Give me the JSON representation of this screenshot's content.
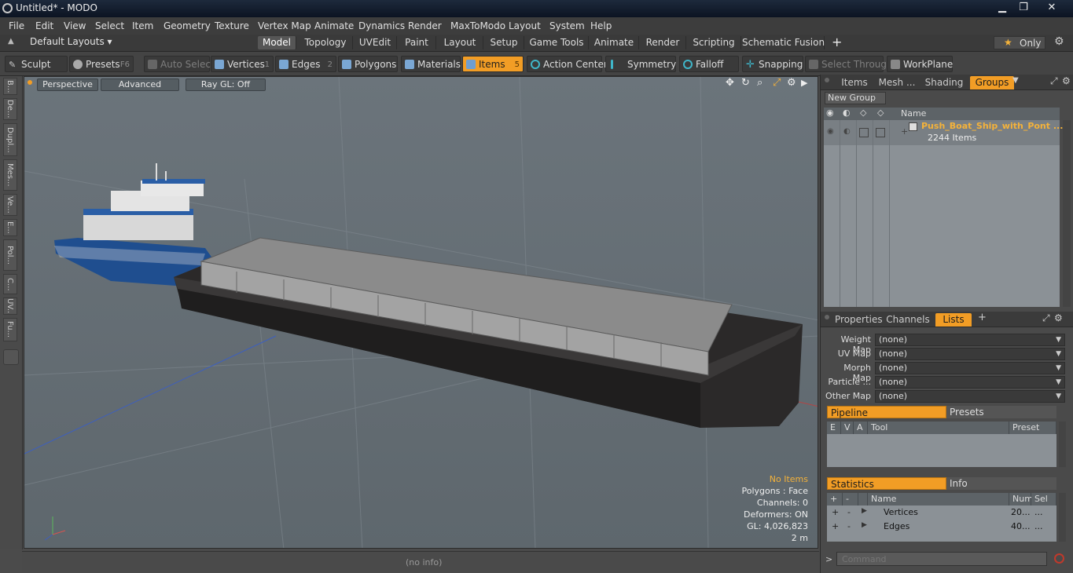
{
  "window": {
    "title": "Untitled* - MODO",
    "minimize": "▁",
    "restore": "❐",
    "close": "✕"
  },
  "menu": [
    "File",
    "Edit",
    "View",
    "Select",
    "Item",
    "Geometry",
    "Texture",
    "Vertex Map",
    "Animate",
    "Dynamics",
    "Render",
    "MaxToModo",
    "Layout",
    "System",
    "Help"
  ],
  "layouts": {
    "label": "Default Layouts ▾",
    "tabs": [
      "Model",
      "Topology",
      "UVEdit",
      "Paint",
      "Layout",
      "Setup",
      "Game Tools",
      "Animate",
      "Render",
      "Scripting",
      "Schematic Fusion"
    ],
    "active": "Model",
    "add": "+",
    "only": "Only",
    "star": "★"
  },
  "toolbar": {
    "sculpt": "Sculpt",
    "presets": "Presets",
    "presets_key": "F6",
    "auto_select": "Auto Select",
    "vertices": "Vertices",
    "vertices_num": "1",
    "edges": "Edges",
    "edges_num": "2",
    "polygons": "Polygons",
    "materials": "Materials",
    "items": "Items",
    "items_num": "5",
    "action_center": "Action Center",
    "symmetry": "Symmetry",
    "falloff": "Falloff",
    "snapping": "Snapping",
    "select_through": "Select Through",
    "workplane": "WorkPlane"
  },
  "left_tabs": [
    "B...",
    "De...",
    "Dupl...",
    "Mes...",
    "Ve...",
    "E...",
    "Pol...",
    "C...",
    "UV...",
    "Fu..."
  ],
  "viewport": {
    "perspective": "Perspective",
    "advanced": "Advanced",
    "raygl": "Ray GL: Off",
    "hud": {
      "selection": "No Items",
      "polygons": "Polygons : Face",
      "channels": "Channels: 0",
      "deformers": "Deformers: ON",
      "gl": "GL: 4,026,823",
      "scale": "2 m"
    }
  },
  "status": {
    "info": "(no info)"
  },
  "groups_panel": {
    "tabs": [
      "Items",
      "Mesh ...",
      "Shading",
      "Groups"
    ],
    "active": "Groups",
    "new_group": "New Group",
    "column_name": "Name",
    "group": {
      "name": "Push_Boat_Ship_with_Pont ...",
      "count": "2244 Items"
    }
  },
  "lists_panel": {
    "tabs": [
      "Properties",
      "Channels",
      "Lists"
    ],
    "active": "Lists",
    "add": "+",
    "maps": [
      {
        "label": "Weight Map",
        "value": "(none)"
      },
      {
        "label": "UV Map",
        "value": "(none)"
      },
      {
        "label": "Morph Map",
        "value": "(none)"
      },
      {
        "label": "Particle ...",
        "value": "(none)"
      },
      {
        "label": "Other Map",
        "value": "(none)"
      }
    ],
    "pipeline": "Pipeline",
    "presets": "Presets",
    "pipeline_cols": {
      "e": "E",
      "v": "V",
      "a": "A",
      "tool": "Tool",
      "preset": "Preset"
    },
    "statistics": "Statistics",
    "info": "Info",
    "stats_cols": {
      "plus": "+",
      "minus": "-",
      "name": "Name",
      "num": "Num",
      "sel": "Sel"
    },
    "stats_rows": [
      {
        "plus": "+",
        "minus": "-",
        "name": "Vertices",
        "num": "20...",
        "sel": "..."
      },
      {
        "plus": "+",
        "minus": "-",
        "name": "Edges",
        "num": "40...",
        "sel": "..."
      }
    ]
  },
  "command": {
    "prompt": ">",
    "placeholder": "Command"
  },
  "colors": {
    "accent": "#f29d25",
    "viewport_bg": "#656e74",
    "hull_blue": "#1f4e8f"
  }
}
